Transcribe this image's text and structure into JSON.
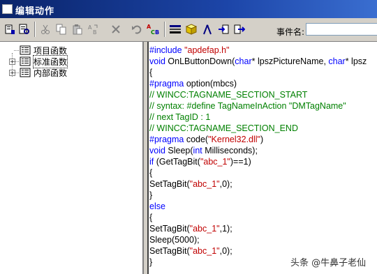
{
  "window": {
    "title": "编辑动作"
  },
  "toolbar": {
    "buttons": [
      {
        "icon": "compile-icon"
      },
      {
        "icon": "find-icon"
      },
      {
        "icon": "cut-icon"
      },
      {
        "icon": "copy-icon"
      },
      {
        "icon": "paste-icon"
      },
      {
        "icon": "replace-icon"
      },
      {
        "icon": "delete-icon"
      },
      {
        "icon": "undo-icon"
      },
      {
        "icon": "abc-tag-icon"
      },
      {
        "icon": "tag-selection-icon"
      },
      {
        "icon": "cube-icon"
      },
      {
        "icon": "compass-icon"
      },
      {
        "icon": "import-icon"
      },
      {
        "icon": "export-icon"
      }
    ],
    "event_name_label": "事件名:",
    "event_name_value": ""
  },
  "tree": {
    "items": [
      {
        "label": "项目函数",
        "expandable": false
      },
      {
        "label": "标准函数",
        "expandable": true,
        "selected": true
      },
      {
        "label": "内部函数",
        "expandable": true
      }
    ]
  },
  "code": {
    "lines": [
      "#include \"apdefap.h\"",
      "void OnLButtonDown(char* lpszPictureName, char* lpsz",
      "{",
      "#pragma option(mbcs)",
      "// WINCC:TAGNAME_SECTION_START",
      "// syntax: #define TagNameInAction \"DMTagName\"",
      "// next TagID : 1",
      "// WINCC:TAGNAME_SECTION_END",
      "#pragma code(\"Kernel32.dll\")",
      "void Sleep(int Milliseconds);",
      "if (GetTagBit(\"abc_1\")==1)",
      "{",
      "SetTagBit(\"abc_1\",0);",
      "}",
      "else",
      "{",
      "SetTagBit(\"abc_1\",1);",
      "Sleep(5000);",
      "SetTagBit(\"abc_1\",0);",
      "}"
    ]
  },
  "watermark": "头条 @牛鼻子老仙"
}
